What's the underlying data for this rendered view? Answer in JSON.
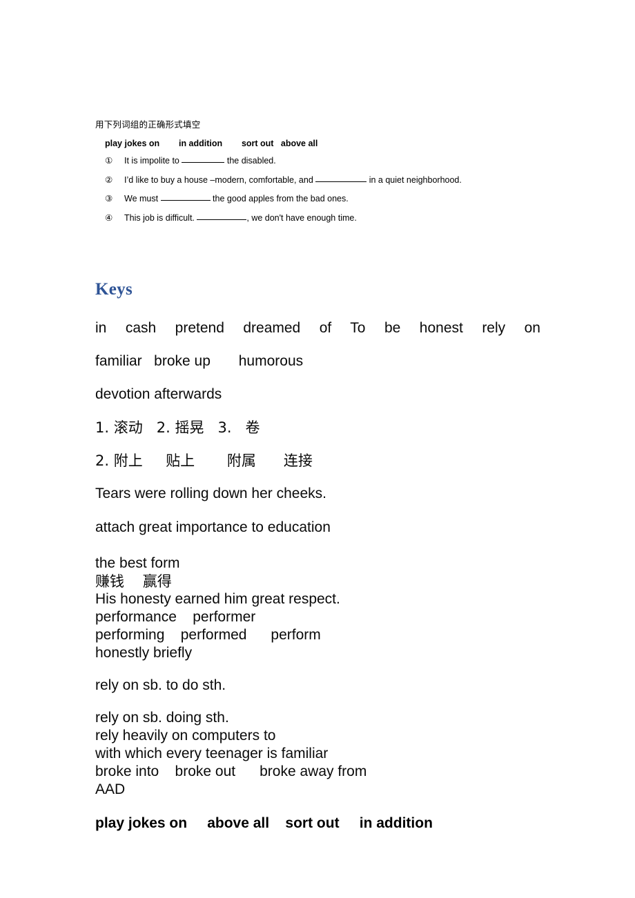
{
  "exercise": {
    "instruction": "用下列词组的正确形式填空",
    "phrase_bank": "play jokes on        in addition        sort out   above all",
    "items": [
      {
        "num": "①",
        "before": "It is impolite to ",
        "after": " the disabled."
      },
      {
        "num": "②",
        "before": "I’d like to buy a house –modern, comfortable, and ",
        "after": " in a quiet neighborhood."
      },
      {
        "num": "③",
        "before": "We must ",
        "after": " the good apples from the bad ones."
      },
      {
        "num": "④",
        "before": "This job is difficult. ",
        "after": ", we don't have enough time."
      }
    ]
  },
  "keys": {
    "heading": "Keys",
    "heading_color": "#2f5496",
    "line_justified": "in cash     pretend dreamed of     To be honest     rely on",
    "lines": [
      "familiar   broke up       humorous",
      "devotion afterwards",
      "1. 滚动   2. 摇晃   3.   卷",
      "2. 附上     贴上       附属      连接",
      "Tears were rolling down her cheeks.",
      "attach great importance to education",
      "the best form",
      "赚钱    赢得",
      "His honesty earned him great respect.",
      "performance    performer",
      "performing    performed      perform",
      "honestly briefly",
      "rely on sb. to do sth.",
      "rely on sb. doing sth.",
      "rely heavily on computers to",
      "with which every teenager is familiar",
      "broke into    broke out      broke away from",
      "AAD"
    ],
    "final_bold_line": "play jokes on     above all    sort out     in addition"
  }
}
